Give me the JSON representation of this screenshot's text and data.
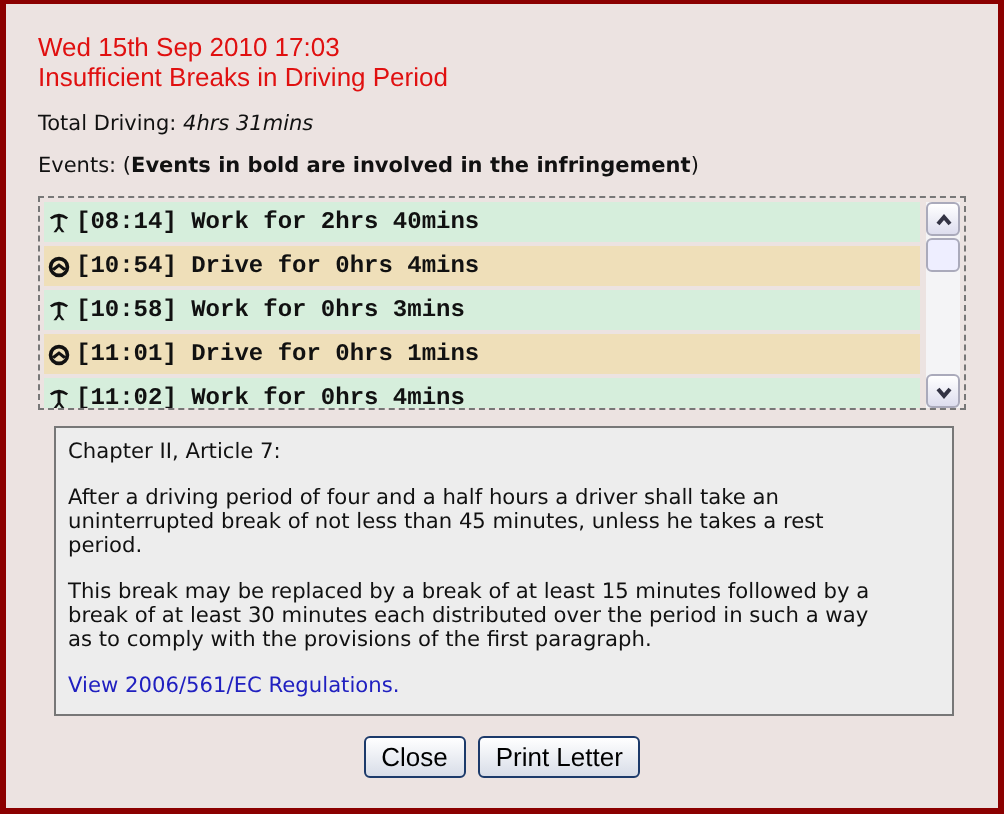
{
  "header": {
    "date": "Wed 15th Sep 2010 17:03",
    "title": "Insufficient Breaks in Driving Period"
  },
  "total_driving": {
    "label": "Total Driving:",
    "value": "4hrs 31mins"
  },
  "events_note": "Events: (**Events in bold are involved in the infringement**)",
  "events": [
    {
      "kind": "work",
      "time": "[08:14]",
      "text": "Work for 2hrs 40mins",
      "involved": true
    },
    {
      "kind": "drive",
      "time": "[10:54]",
      "text": "Drive for 0hrs 4mins",
      "involved": true
    },
    {
      "kind": "work",
      "time": "[10:58]",
      "text": "Work for 0hrs 3mins",
      "involved": true
    },
    {
      "kind": "drive",
      "time": "[11:01]",
      "text": "Drive for 0hrs 1mins",
      "involved": true
    },
    {
      "kind": "work",
      "time": "[11:02]",
      "text": "Work for 0hrs 4mins",
      "involved": true
    }
  ],
  "regulation": {
    "heading": "Chapter II, Article 7:",
    "paragraphs": [
      "After a driving period of four and a half hours a driver shall take an uninterrupted break of not less than 45 minutes, unless he takes a rest period.",
      "This break may be replaced by a break of at least 15 minutes followed by a break of at least 30 minutes each distributed over the period in such a way as to comply with the provisions of the first paragraph."
    ],
    "link": "View 2006/561/EC Regulations."
  },
  "buttons": [
    "Close",
    "Print Letter"
  ]
}
